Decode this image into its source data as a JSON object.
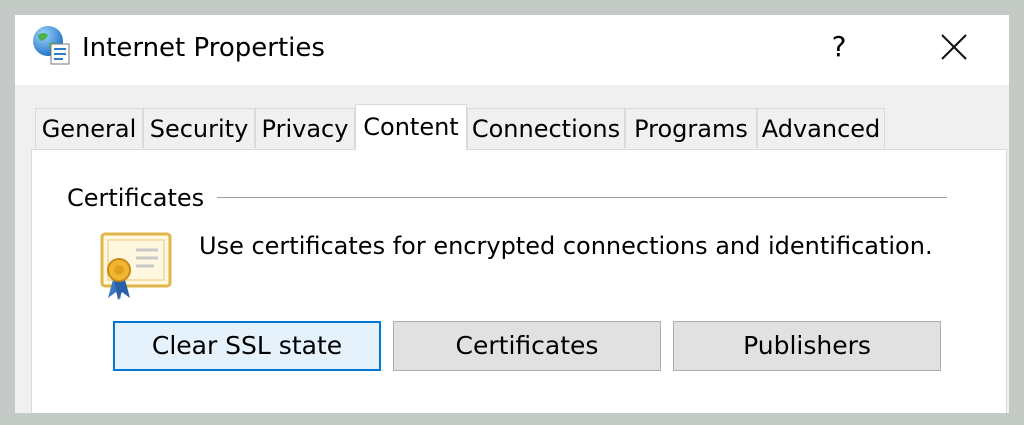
{
  "window": {
    "title": "Internet Properties",
    "help_label": "?",
    "app_icon": "globe-document-icon",
    "close_icon": "close-icon"
  },
  "tabs": [
    {
      "label": "General"
    },
    {
      "label": "Security"
    },
    {
      "label": "Privacy"
    },
    {
      "label": "Content",
      "active": true
    },
    {
      "label": "Connections"
    },
    {
      "label": "Programs"
    },
    {
      "label": "Advanced"
    }
  ],
  "certificates_group": {
    "label": "Certificates",
    "icon": "certificate-icon",
    "description": "Use certificates for encrypted connections and identification.",
    "buttons": [
      {
        "label": "Clear SSL state",
        "focused": true
      },
      {
        "label": "Certificates"
      },
      {
        "label": "Publishers"
      }
    ]
  },
  "colors": {
    "focus_border": "#0078d7",
    "button_face": "#e1e1e1",
    "backdrop": "#c4cac6"
  }
}
